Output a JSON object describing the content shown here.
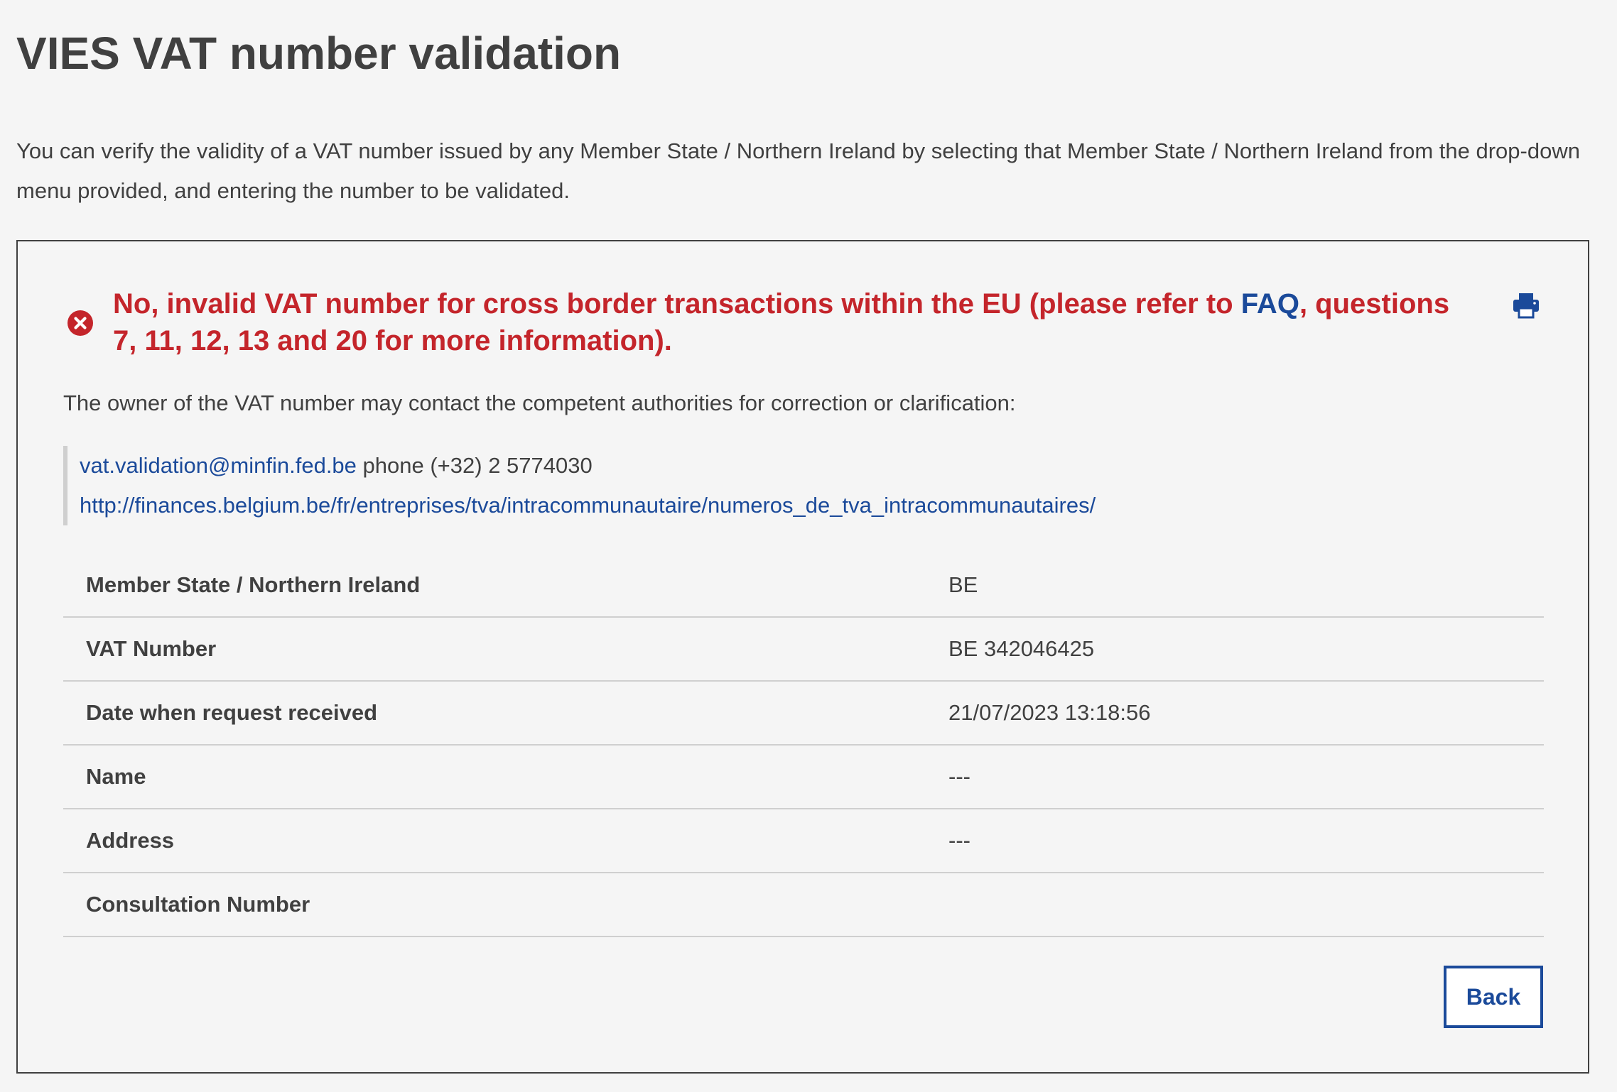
{
  "page": {
    "title": "VIES VAT number validation",
    "intro": "You can verify the validity of a VAT number issued by any Member State / Northern Ireland by selecting that Member State / Northern Ireland from the drop-down menu provided, and entering the number to be validated."
  },
  "result": {
    "status": "invalid",
    "message_prefix": "No, invalid VAT number for cross border transactions within the EU (please refer to ",
    "faq_link": "FAQ",
    "message_suffix": ", questions 7, 11, 12, 13 and 20 for more information).",
    "status_color": "#c4252b",
    "link_color": "#1b4a9a",
    "error_icon": "close-circle-icon",
    "print_icon": "print-icon"
  },
  "contact": {
    "intro": "The owner of the VAT number may contact the competent authorities for correction or clarification:",
    "email": "vat.validation@minfin.fed.be",
    "phone": "phone (+32) 2 5774030",
    "website": "http://finances.belgium.be/fr/entreprises/tva/intracommunautaire/numeros_de_tva_intracommunautaires/"
  },
  "details": {
    "rows": [
      {
        "label": "Member State / Northern Ireland",
        "value": "BE"
      },
      {
        "label": "VAT Number",
        "value": "BE 342046425"
      },
      {
        "label": "Date when request received",
        "value": "21/07/2023 13:18:56"
      },
      {
        "label": "Name",
        "value": "---"
      },
      {
        "label": "Address",
        "value": "---"
      },
      {
        "label": "Consultation Number",
        "value": ""
      }
    ]
  },
  "actions": {
    "back_label": "Back"
  }
}
